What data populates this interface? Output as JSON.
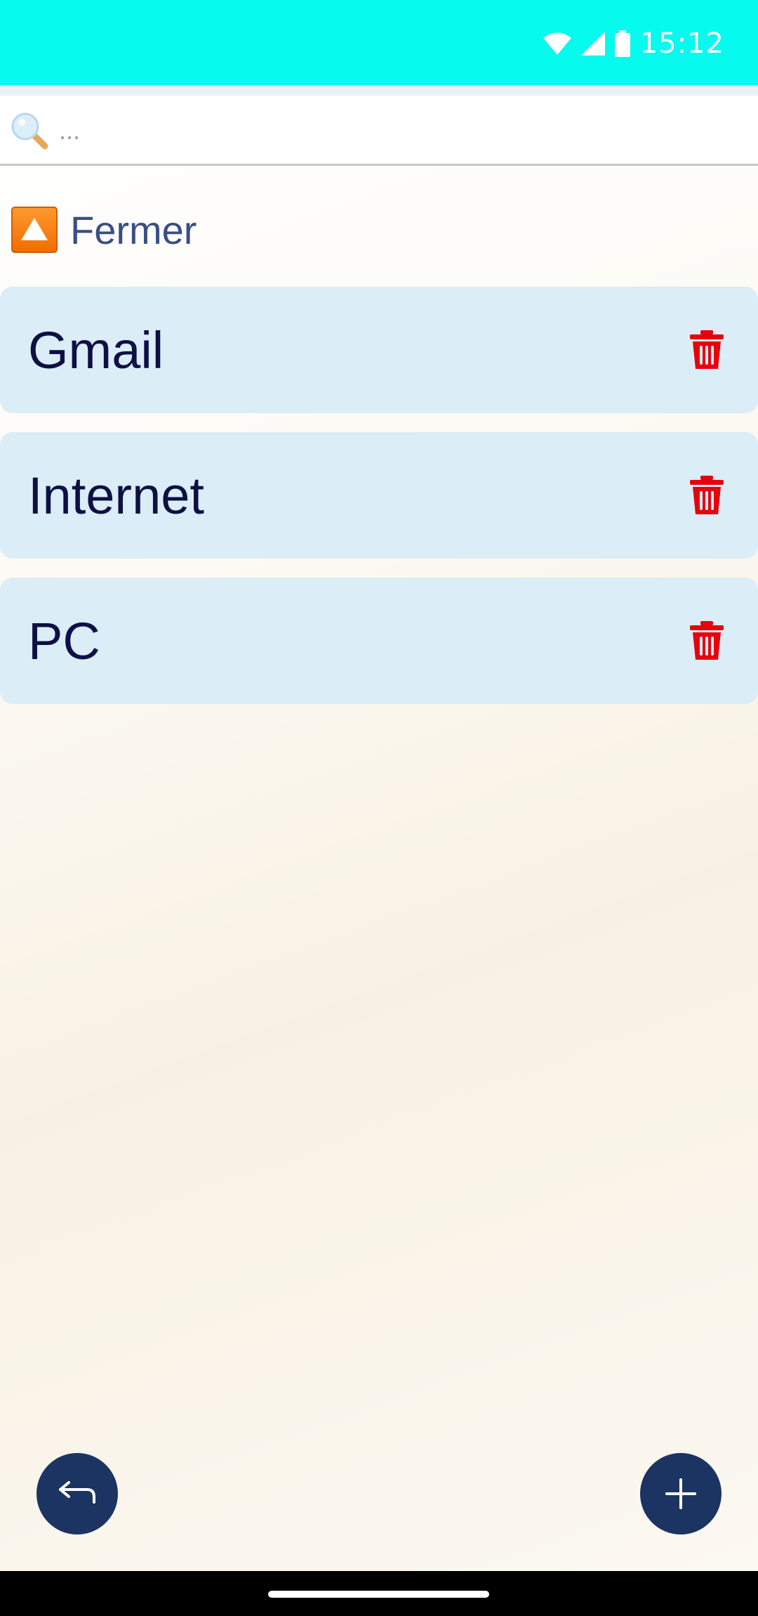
{
  "status_bar": {
    "time": "15:12",
    "icons": [
      "wifi-icon",
      "signal-icon",
      "battery-icon"
    ],
    "background": "#05fbee"
  },
  "search": {
    "placeholder": "...",
    "value": ""
  },
  "close_toggle": {
    "label": "Fermer",
    "icon": "warning-triangle-icon"
  },
  "list": {
    "items": [
      {
        "label": "Gmail",
        "action_icon": "trash-icon"
      },
      {
        "label": "Internet",
        "action_icon": "trash-icon"
      },
      {
        "label": "PC",
        "action_icon": "trash-icon"
      }
    ]
  },
  "fab": {
    "back_icon": "return-arrow-icon",
    "add_icon": "plus-icon",
    "color": "#1b3462"
  },
  "colors": {
    "item_background": "#dbedf6",
    "item_text": "#0e0f45",
    "delete": "#e8000d",
    "close_label": "#3a4e85"
  }
}
